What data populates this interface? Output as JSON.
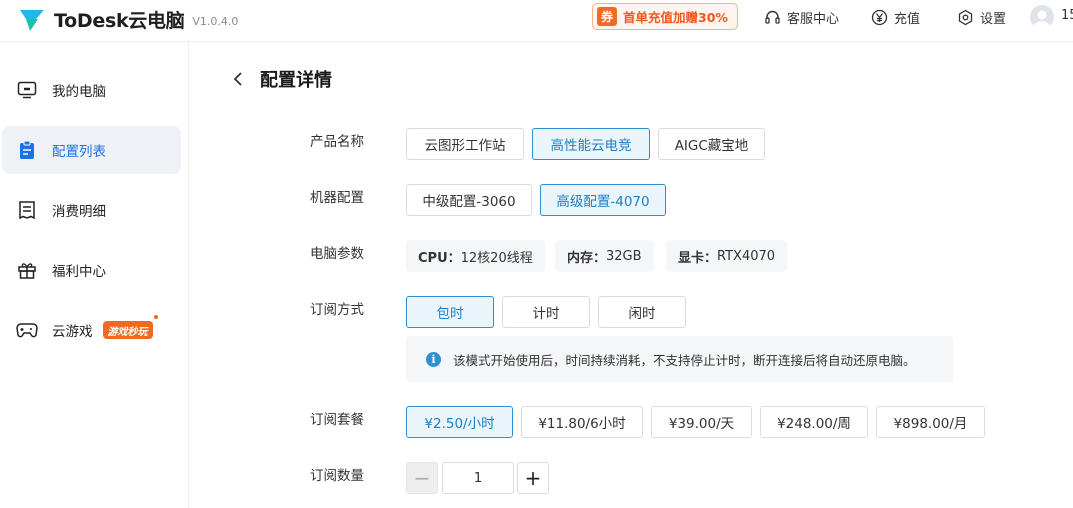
{
  "header": {
    "app_name": "ToDesk云电脑",
    "version": "V1.0.4.0",
    "promo_badge": "券",
    "promo_text": "首单充值加赠30%",
    "service_label": "客服中心",
    "recharge_label": "充值",
    "settings_label": "设置",
    "user_fragment": "15"
  },
  "sidebar": {
    "items": [
      {
        "label": "我的电脑",
        "icon": "monitor-icon"
      },
      {
        "label": "配置列表",
        "icon": "clipboard-icon"
      },
      {
        "label": "消费明细",
        "icon": "receipt-icon"
      },
      {
        "label": "福利中心",
        "icon": "gift-icon"
      },
      {
        "label": "云游戏",
        "icon": "gamepad-icon",
        "tag": "游戏秒玩"
      }
    ],
    "active_index": 1
  },
  "page": {
    "title": "配置详情"
  },
  "form": {
    "product": {
      "label": "产品名称",
      "options": [
        "云图形工作站",
        "高性能云电竞",
        "AIGC藏宝地"
      ],
      "selected": "高性能云电竞"
    },
    "machine": {
      "label": "机器配置",
      "options": [
        "中级配置-3060",
        "高级配置-4070"
      ],
      "selected": "高级配置-4070"
    },
    "params": {
      "label": "电脑参数",
      "cpu_key": "CPU：",
      "cpu_val": "12核20线程",
      "mem_key": "内存：",
      "mem_val": "32GB",
      "gpu_key": "显卡：",
      "gpu_val": "RTX4070"
    },
    "subscription_mode": {
      "label": "订阅方式",
      "options": [
        "包时",
        "计时",
        "闲时"
      ],
      "selected": "包时",
      "notice": "该模式开始使用后，时间持续消耗，不支持停止计时，断开连接后将自动还原电脑。"
    },
    "plan": {
      "label": "订阅套餐",
      "options": [
        "¥2.50/小时",
        "¥11.80/6小时",
        "¥39.00/天",
        "¥248.00/周",
        "¥898.00/月"
      ],
      "selected": "¥2.50/小时"
    },
    "quantity": {
      "label": "订阅数量",
      "value": "1",
      "minus": "−",
      "plus": "+"
    }
  },
  "colors": {
    "accent": "#2f8fd0",
    "promo": "#f36a27",
    "logo": "#17c2a8"
  }
}
